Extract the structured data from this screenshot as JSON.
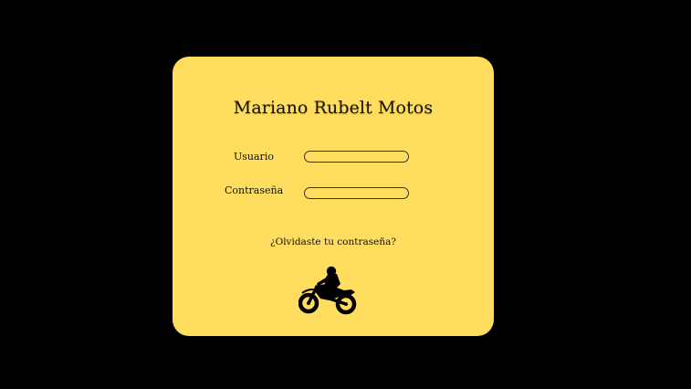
{
  "login": {
    "title": "Mariano Rubelt Motos",
    "username_label": "Usuario",
    "username_value": "",
    "password_label": "Contraseña",
    "password_value": "",
    "forgot_link": "¿Olvidaste tu contraseña?",
    "logo_icon": "motorcycle-rider-icon"
  },
  "colors": {
    "background": "#000000",
    "card": "#FFDD5E",
    "text": "#111111"
  }
}
